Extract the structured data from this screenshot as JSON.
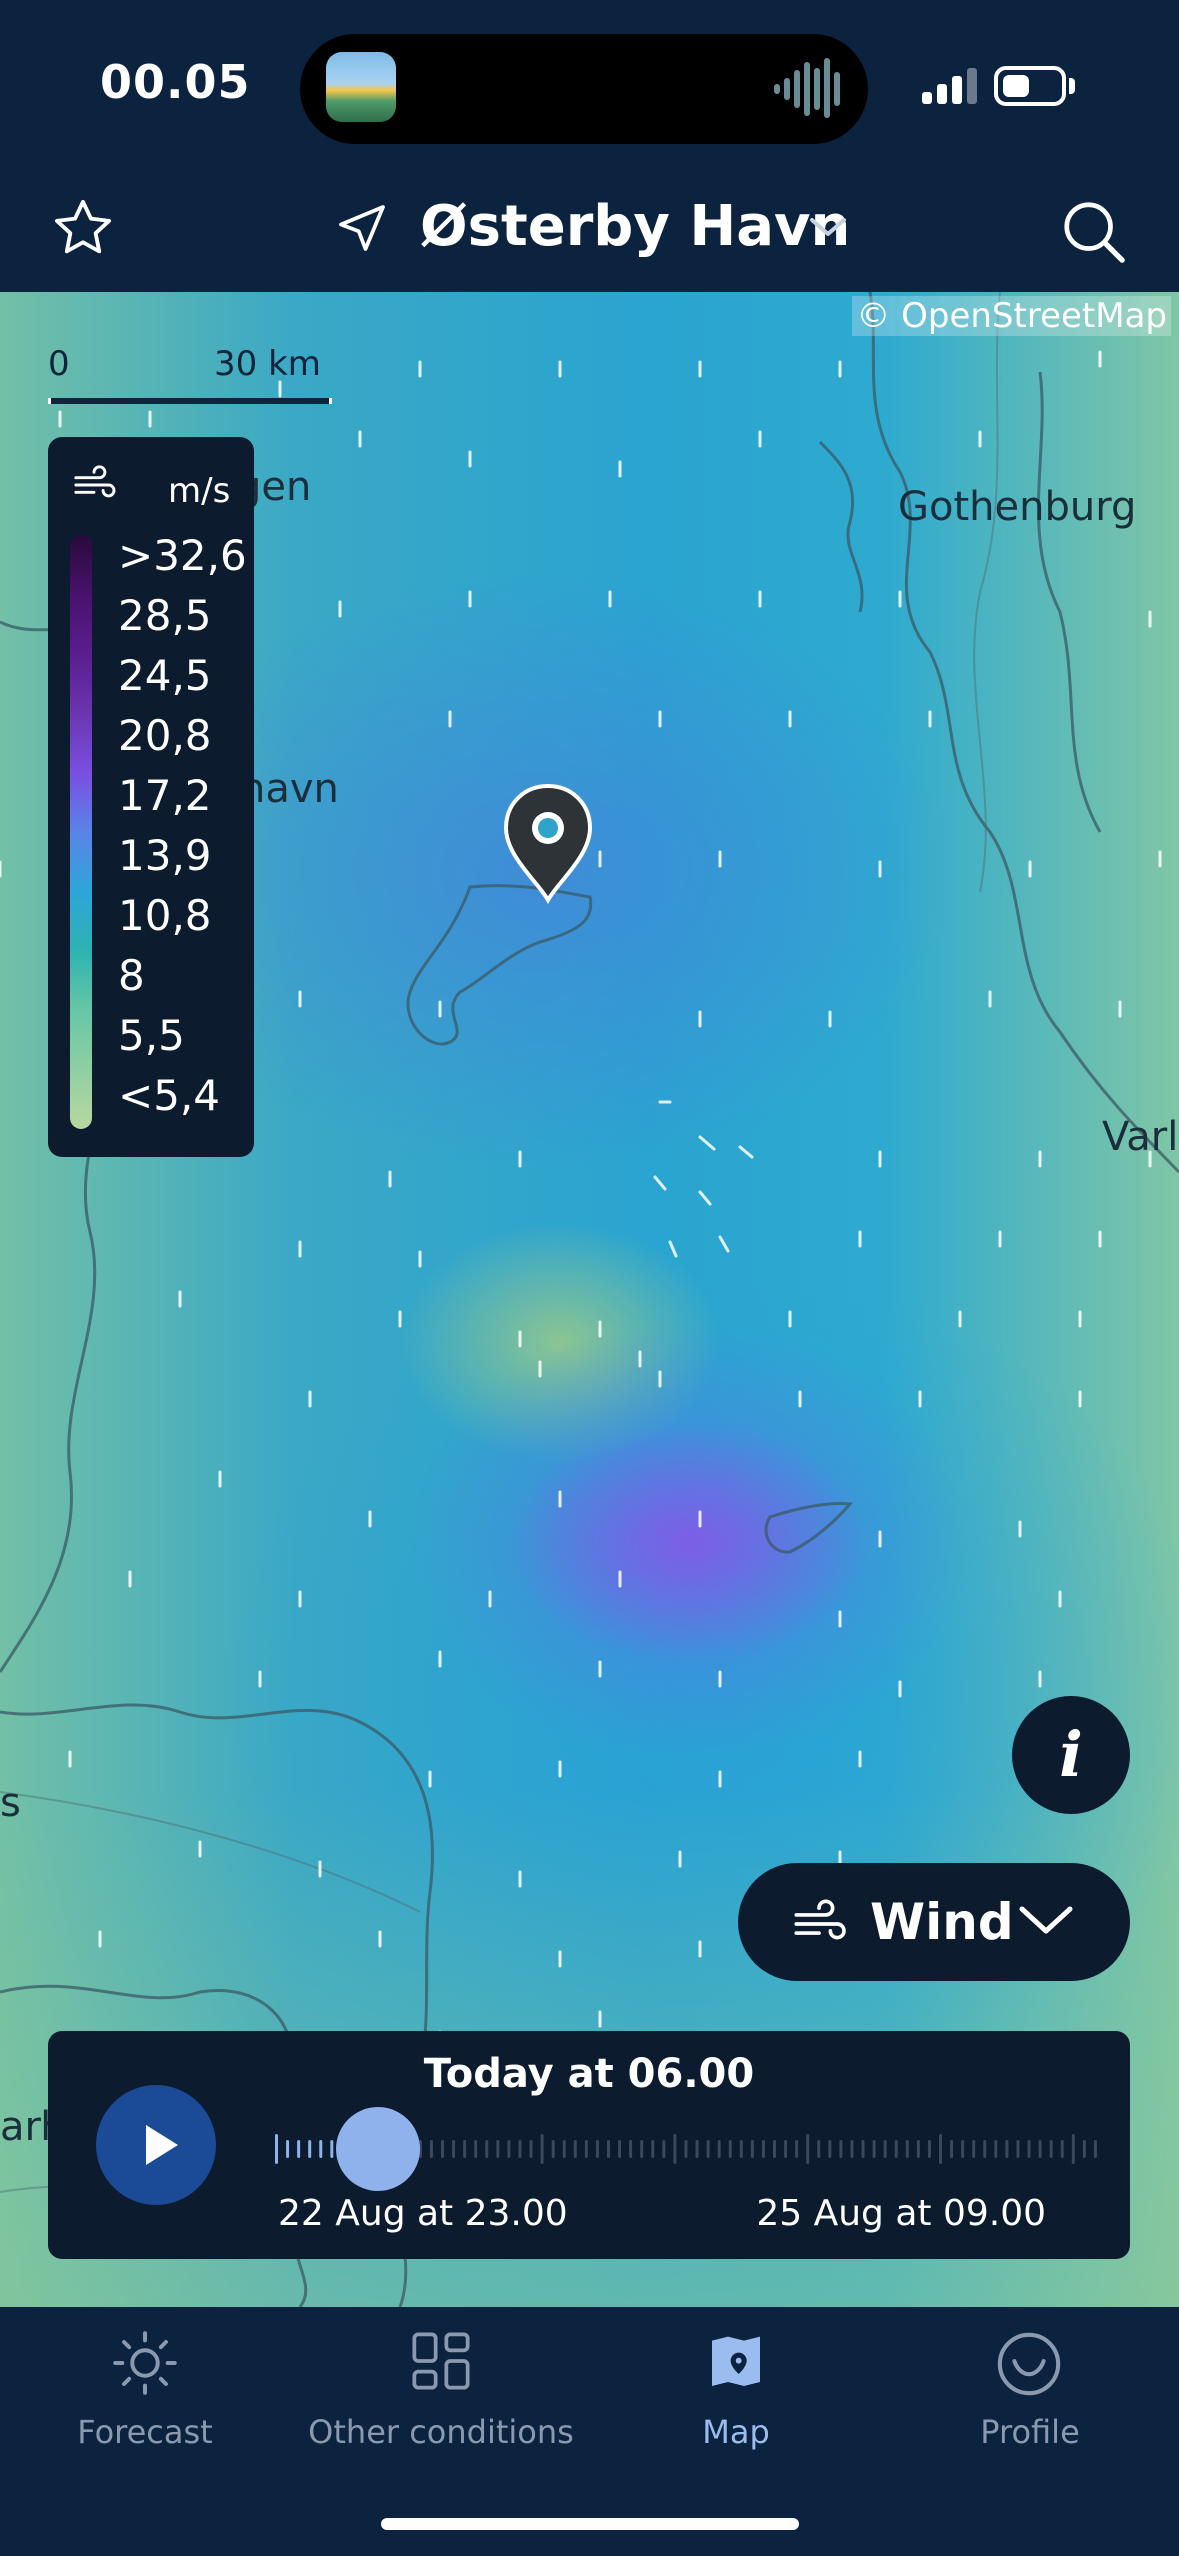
{
  "status_bar": {
    "time": "00.05"
  },
  "header": {
    "location": "Østerby Havn"
  },
  "map": {
    "attribution": "© OpenStreetMap",
    "scale": {
      "zero": "0",
      "distance": "30 km"
    },
    "places": {
      "gothenburg": "Gothenburg",
      "gen": "gen",
      "havn": "havn",
      "varl": "Varl",
      "s": "s",
      "arh": "arh"
    }
  },
  "legend": {
    "unit": "m/s",
    "values": [
      ">32,6",
      "28,5",
      "24,5",
      "20,8",
      "17,2",
      "13,9",
      "10,8",
      "8",
      "5,5",
      "<5,4"
    ]
  },
  "info_button": {
    "label": "i"
  },
  "layer_button": {
    "label": "Wind"
  },
  "timeline": {
    "title": "Today at 06.00",
    "start": "22 Aug at 23.00",
    "end": "25 Aug at 09.00",
    "progress": 0.12
  },
  "tabs": [
    {
      "label": "Forecast",
      "icon": "sun-icon",
      "active": false
    },
    {
      "label": "Other conditions",
      "icon": "grid-icon",
      "active": false
    },
    {
      "label": "Map",
      "icon": "map-icon",
      "active": true
    },
    {
      "label": "Profile",
      "icon": "smile-icon",
      "active": false
    }
  ],
  "colors": {
    "navy": "#0c2340",
    "panel": "#0c1b2e",
    "accent": "#9bbcef",
    "play": "#1b4a97"
  }
}
